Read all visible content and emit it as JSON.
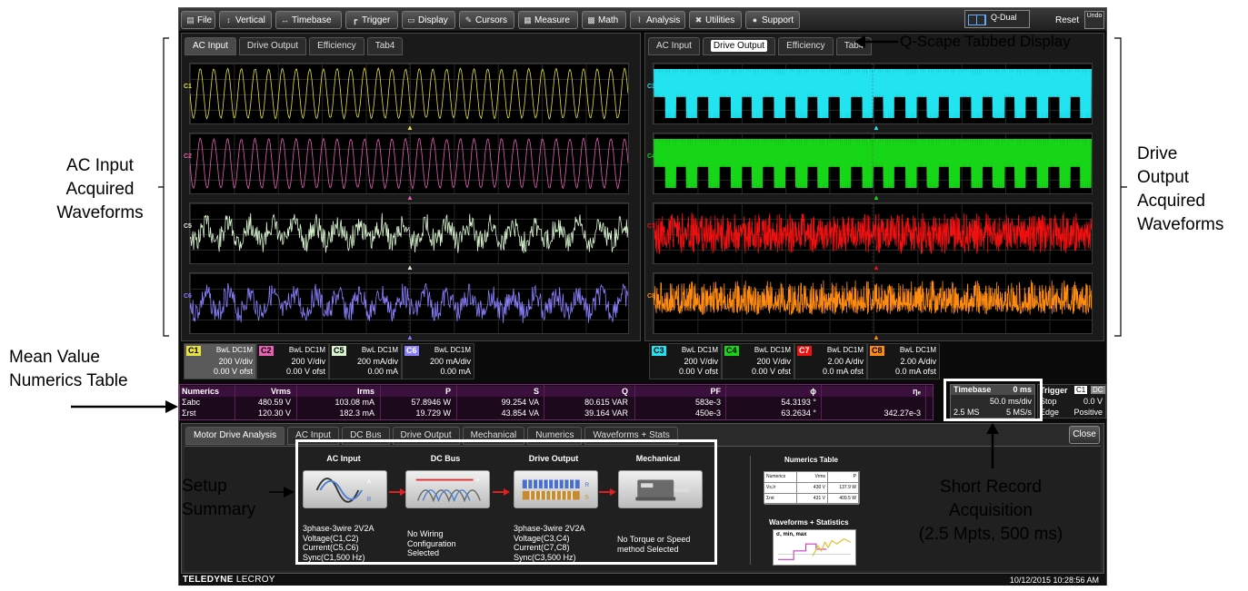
{
  "menu": {
    "items": [
      {
        "label": "File",
        "icon": "file-icon"
      },
      {
        "label": "Vertical",
        "icon": "vertical-arrows-icon"
      },
      {
        "label": "Timebase",
        "icon": "horizontal-arrows-icon"
      },
      {
        "label": "Trigger",
        "icon": "trigger-icon"
      },
      {
        "label": "Display",
        "icon": "display-icon"
      },
      {
        "label": "Cursors",
        "icon": "cursors-icon"
      },
      {
        "label": "Measure",
        "icon": "measure-icon"
      },
      {
        "label": "Math",
        "icon": "math-icon"
      },
      {
        "label": "Analysis",
        "icon": "analysis-icon"
      },
      {
        "label": "Utilities",
        "icon": "utilities-icon"
      },
      {
        "label": "Support",
        "icon": "info-icon"
      }
    ],
    "display_mode": "Q-Dual",
    "reset_label": "Reset",
    "undo_label": "Undo"
  },
  "left_panel": {
    "tabs": [
      "AC Input",
      "Drive Output",
      "Efficiency",
      "Tab4"
    ],
    "active_tab": 0,
    "traces": [
      {
        "label": "C1",
        "color": "#e8e23a"
      },
      {
        "label": "C2",
        "color": "#e85fb4"
      },
      {
        "label": "C5",
        "color": "#d9f5d0"
      },
      {
        "label": "C6",
        "color": "#8a80ff"
      }
    ]
  },
  "right_panel": {
    "tabs": [
      "AC Input",
      "Drive Output",
      "Efficiency",
      "Tab4"
    ],
    "active_tab": 1,
    "traces": [
      {
        "label": "C3",
        "color": "#22e4f0"
      },
      {
        "label": "C4",
        "color": "#17d617"
      },
      {
        "label": "C7",
        "color": "#f01010"
      },
      {
        "label": "C8",
        "color": "#ff8c10"
      }
    ]
  },
  "channels_left": [
    {
      "tag": "C1",
      "color": "#e8e23a",
      "coupling": "BwL DC1M",
      "scale": "200 V/div",
      "offset": "0.00 V ofst",
      "selected": true
    },
    {
      "tag": "C2",
      "color": "#e85fb4",
      "coupling": "BwL DC1M",
      "scale": "200 V/div",
      "offset": "0.00 V ofst",
      "selected": false
    },
    {
      "tag": "C5",
      "color": "#d9f5d0",
      "coupling": "BwL DC1M",
      "scale": "200 mA/div",
      "offset": "0.00 mA",
      "selected": false
    },
    {
      "tag": "C6",
      "color": "#8a80ff",
      "coupling": "BwL DC1M",
      "scale": "200 mA/div",
      "offset": "0.00 mA",
      "selected": false
    }
  ],
  "channels_right": [
    {
      "tag": "C3",
      "color": "#22e4f0",
      "coupling": "BwL DC1M",
      "scale": "200 V/div",
      "offset": "0.00 V ofst",
      "selected": false
    },
    {
      "tag": "C4",
      "color": "#17d617",
      "coupling": "BwL DC1M",
      "scale": "200 V/div",
      "offset": "0.00 V ofst",
      "selected": false
    },
    {
      "tag": "C7",
      "color": "#f01010",
      "coupling": "BwL DC1M",
      "scale": "2.00 A/div",
      "offset": "0.0 mA ofst",
      "selected": false
    },
    {
      "tag": "C8",
      "color": "#ff8c10",
      "coupling": "BwL DC1M",
      "scale": "2.00 A/div",
      "offset": "0.0 mA ofst",
      "selected": false
    }
  ],
  "numerics": {
    "headers": [
      "Numerics",
      "Vrms",
      "Irms",
      "P",
      "S",
      "Q",
      "PF",
      "ϕ",
      "ηₑ"
    ],
    "rows": [
      [
        "Σabc",
        "480.59 V",
        "103.08 mA",
        "57.8946 W",
        "99.254 VA",
        "80.615 VAR",
        "583e-3",
        "54.3193 °",
        ""
      ],
      [
        "Σrst",
        "120.30 V",
        "182.3 mA",
        "19.729 W",
        "43.854 VA",
        "39.164 VAR",
        "450e-3",
        "63.2634 °",
        "342.27e-3"
      ]
    ]
  },
  "timebase": {
    "label": "Timebase",
    "delay": "0 ms",
    "scale": "50.0 ms/div",
    "points": "2.5 MS",
    "rate": "5 MS/s"
  },
  "trigger": {
    "label": "Trigger",
    "source": "C1",
    "coupling": "DC",
    "mode": "Stop",
    "level": "0.0 V",
    "type": "Edge",
    "slope": "Positive"
  },
  "dialog": {
    "tabs": [
      "Motor Drive Analysis",
      "AC Input",
      "DC Bus",
      "Drive Output",
      "Mechanical",
      "Numerics",
      "Waveforms + Stats"
    ],
    "close_label": "Close",
    "steps": [
      {
        "title": "AC Input",
        "desc": "3phase-3wire 2V2A\nVoltage(C1,C2)\nCurrent(C5,C6)\nSync(C1,500 Hz)"
      },
      {
        "title": "DC Bus",
        "desc": "No Wiring\nConfiguration\nSelected"
      },
      {
        "title": "Drive Output",
        "desc": "3phase-3wire 2V2A\nVoltage(C3,C4)\nCurrent(C7,C8)\nSync(C3,500 Hz)"
      },
      {
        "title": "Mechanical",
        "desc": "No Torque or Speed\nmethod Selected"
      }
    ],
    "numerics_table_title": "Numerics Table",
    "mini_table": [
      [
        "Numerics",
        "Vrms",
        "P"
      ],
      [
        "Vs,Ir",
        "430 V",
        "137.9 W"
      ],
      [
        "Σrst",
        "431 V",
        "409.5 W"
      ]
    ],
    "waveforms_stats_title": "Waveforms + Statistics",
    "stats_label": "σ, min, max"
  },
  "status": {
    "brand": "TELEDYNE",
    "brand2": "LECROY",
    "datetime": "10/12/2015 10:28:56 AM"
  },
  "annotations": {
    "qscape": "Q-Scape Tabbed Display",
    "ac_input": [
      "AC Input",
      "Acquired",
      "Waveforms"
    ],
    "drive_output": [
      "Drive",
      "Output",
      "Acquired",
      "Waveforms"
    ],
    "numerics": [
      "Mean Value",
      "Numerics Table"
    ],
    "setup": [
      "Setup",
      "Summary"
    ],
    "short_record": [
      "Short Record",
      "Acquisition",
      "(2.5 Mpts, 500 ms)"
    ]
  }
}
